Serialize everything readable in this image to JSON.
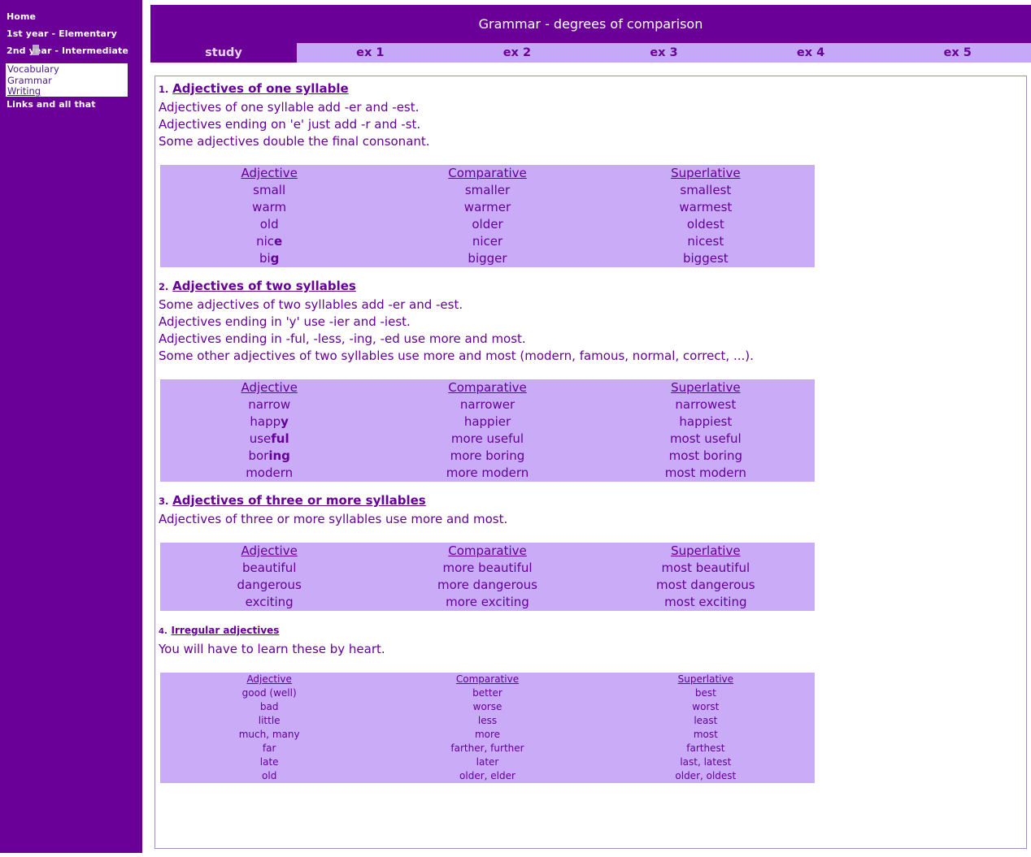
{
  "sidebar": {
    "links": [
      {
        "label": "Home",
        "name": "sidebar-link-home"
      },
      {
        "label": "1st year - Elementary",
        "name": "sidebar-link-1st-year"
      },
      {
        "label": "2nd year - Intermediate",
        "name": "sidebar-link-2nd-year"
      },
      {
        "label": "Links and all that",
        "name": "sidebar-link-links"
      }
    ],
    "submenu": [
      {
        "label": "Vocabulary"
      },
      {
        "label": "Grammar"
      },
      {
        "label": "Writing"
      }
    ]
  },
  "header": {
    "title": "Grammar - degrees of comparison"
  },
  "tabs": [
    {
      "label": "study",
      "active": true
    },
    {
      "label": "ex 1",
      "active": false
    },
    {
      "label": "ex 2",
      "active": false
    },
    {
      "label": "ex 3",
      "active": false
    },
    {
      "label": "ex 4",
      "active": false
    },
    {
      "label": "ex 5",
      "active": false
    }
  ],
  "columns": {
    "adjective": "Adjective",
    "comparative": "Comparative",
    "superlative": "Superlative"
  },
  "sections": [
    {
      "number": "1.",
      "title": "Adjectives of one syllable",
      "lines": [
        "Adjectives of one syllable add -er and -est.",
        "Adjectives ending on 'e' just add -r and -st.",
        "Some adjectives double the final consonant."
      ],
      "rows": [
        {
          "adjective": "small",
          "bold": "",
          "comparative": "smaller",
          "superlative": "smallest"
        },
        {
          "adjective": "warm",
          "bold": "",
          "comparative": "warmer",
          "superlative": "warmest"
        },
        {
          "adjective": "old",
          "bold": "",
          "comparative": "older",
          "superlative": "oldest"
        },
        {
          "adjective": "nic",
          "bold": "e",
          "comparative": "nicer",
          "superlative": "nicest"
        },
        {
          "adjective": "bi",
          "bold": "g",
          "comparative": "bigger",
          "superlative": "biggest"
        }
      ]
    },
    {
      "number": "2.",
      "title": "Adjectives of two syllables",
      "lines": [
        "Some adjectives of two syllables add -er and -est.",
        "Adjectives ending in 'y' use -ier and -iest.",
        "Adjectives ending in -ful, -less, -ing, -ed use more and most.",
        "Some other adjectives of two syllables use more and most (modern, famous, normal, correct, ...)."
      ],
      "rows": [
        {
          "adjective": "narrow",
          "bold": "",
          "comparative": "narrower",
          "superlative": "narrowest"
        },
        {
          "adjective": "happ",
          "bold": "y",
          "comparative": "happier",
          "superlative": "happiest"
        },
        {
          "adjective": "use",
          "bold": "ful",
          "comparative": "more useful",
          "superlative": "most useful"
        },
        {
          "adjective": "bor",
          "bold": "ing",
          "comparative": "more boring",
          "superlative": "most boring"
        },
        {
          "adjective": "modern",
          "bold": "",
          "comparative": "more modern",
          "superlative": "most modern"
        }
      ]
    },
    {
      "number": "3.",
      "title": "Adjectives of three or more syllables",
      "lines": [
        "Adjectives of three or more syllables use more and most."
      ],
      "rows": [
        {
          "adjective": "beautiful",
          "bold": "",
          "comparative": "more beautiful",
          "superlative": "most beautiful"
        },
        {
          "adjective": "dangerous",
          "bold": "",
          "comparative": "more dangerous",
          "superlative": "most dangerous"
        },
        {
          "adjective": "exciting",
          "bold": "",
          "comparative": "more exciting",
          "superlative": "most exciting"
        }
      ]
    },
    {
      "number": "4.",
      "title": "Irregular adjectives",
      "small": true,
      "lines": [
        "You will have to learn these by heart."
      ],
      "rows": [
        {
          "adjective": "good (well)",
          "bold": "",
          "comparative": "better",
          "superlative": "best"
        },
        {
          "adjective": "bad",
          "bold": "",
          "comparative": "worse",
          "superlative": "worst"
        },
        {
          "adjective": "little",
          "bold": "",
          "comparative": "less",
          "superlative": "least"
        },
        {
          "adjective": "much, many",
          "bold": "",
          "comparative": "more",
          "superlative": "most"
        },
        {
          "adjective": "far",
          "bold": "",
          "comparative": "farther, further",
          "superlative": "farthest"
        },
        {
          "adjective": "late",
          "bold": "",
          "comparative": "later",
          "superlative": "last, latest"
        },
        {
          "adjective": "old",
          "bold": "",
          "comparative": "older, elder",
          "superlative": "older, oldest"
        }
      ]
    }
  ],
  "colors": {
    "purple_dark": "#6B0099",
    "purple_light": "#C9ABF8",
    "tab_light": "#C5A8F7",
    "text_purple": "#660099"
  }
}
